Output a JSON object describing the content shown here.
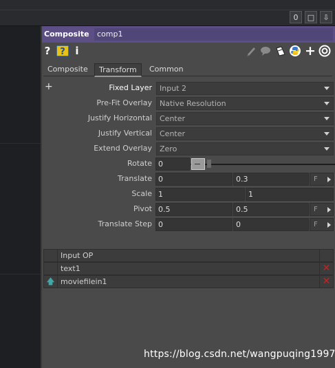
{
  "topbar": {
    "buttons": [
      "0",
      "□",
      "⇩"
    ]
  },
  "header": {
    "op_type": "Composite",
    "op_name": "comp1"
  },
  "icons": [
    "help-icon",
    "python-help-icon",
    "info-icon",
    "pencil-icon",
    "comment-icon",
    "clone-icon",
    "python-icon",
    "add-icon",
    "viewer-icon"
  ],
  "icon_glyphs": {
    "help": "?",
    "info": "i",
    "add": "+"
  },
  "tabs": [
    {
      "label": "Composite",
      "active": false
    },
    {
      "label": "Transform",
      "active": true
    },
    {
      "label": "Common",
      "active": false
    }
  ],
  "expand": "+",
  "params": {
    "fixed_layer": {
      "label": "Fixed Layer",
      "value": "Input 2"
    },
    "prefit_overlay": {
      "label": "Pre-Fit Overlay",
      "value": "Native Resolution"
    },
    "justify_horizontal": {
      "label": "Justify Horizontal",
      "value": "Center"
    },
    "justify_vertical": {
      "label": "Justify Vertical",
      "value": "Center"
    },
    "extend_overlay": {
      "label": "Extend Overlay",
      "value": "Zero"
    },
    "rotate": {
      "label": "Rotate",
      "value": "0"
    },
    "translate": {
      "label": "Translate",
      "x": "0",
      "y": "0.3",
      "mode": "F"
    },
    "scale": {
      "label": "Scale",
      "x": "1",
      "y": "1"
    },
    "pivot": {
      "label": "Pivot",
      "x": "0.5",
      "y": "0.5",
      "mode": "F"
    },
    "translate_step": {
      "label": "Translate Step",
      "x": "0",
      "y": "0",
      "mode": "F"
    }
  },
  "inputs_table": {
    "header": "Input OP",
    "rows": [
      {
        "name": "text1"
      },
      {
        "name": "moviefilein1"
      }
    ]
  },
  "watermark": "https://blog.csdn.net/wangpuqing1997",
  "colors": {
    "header_bg": "#5d4f86",
    "panel_bg": "#4a4a4a",
    "delete_red": "#d11e1e",
    "python_blue": "#3b79c9",
    "python_yellow": "#f2c21a"
  }
}
